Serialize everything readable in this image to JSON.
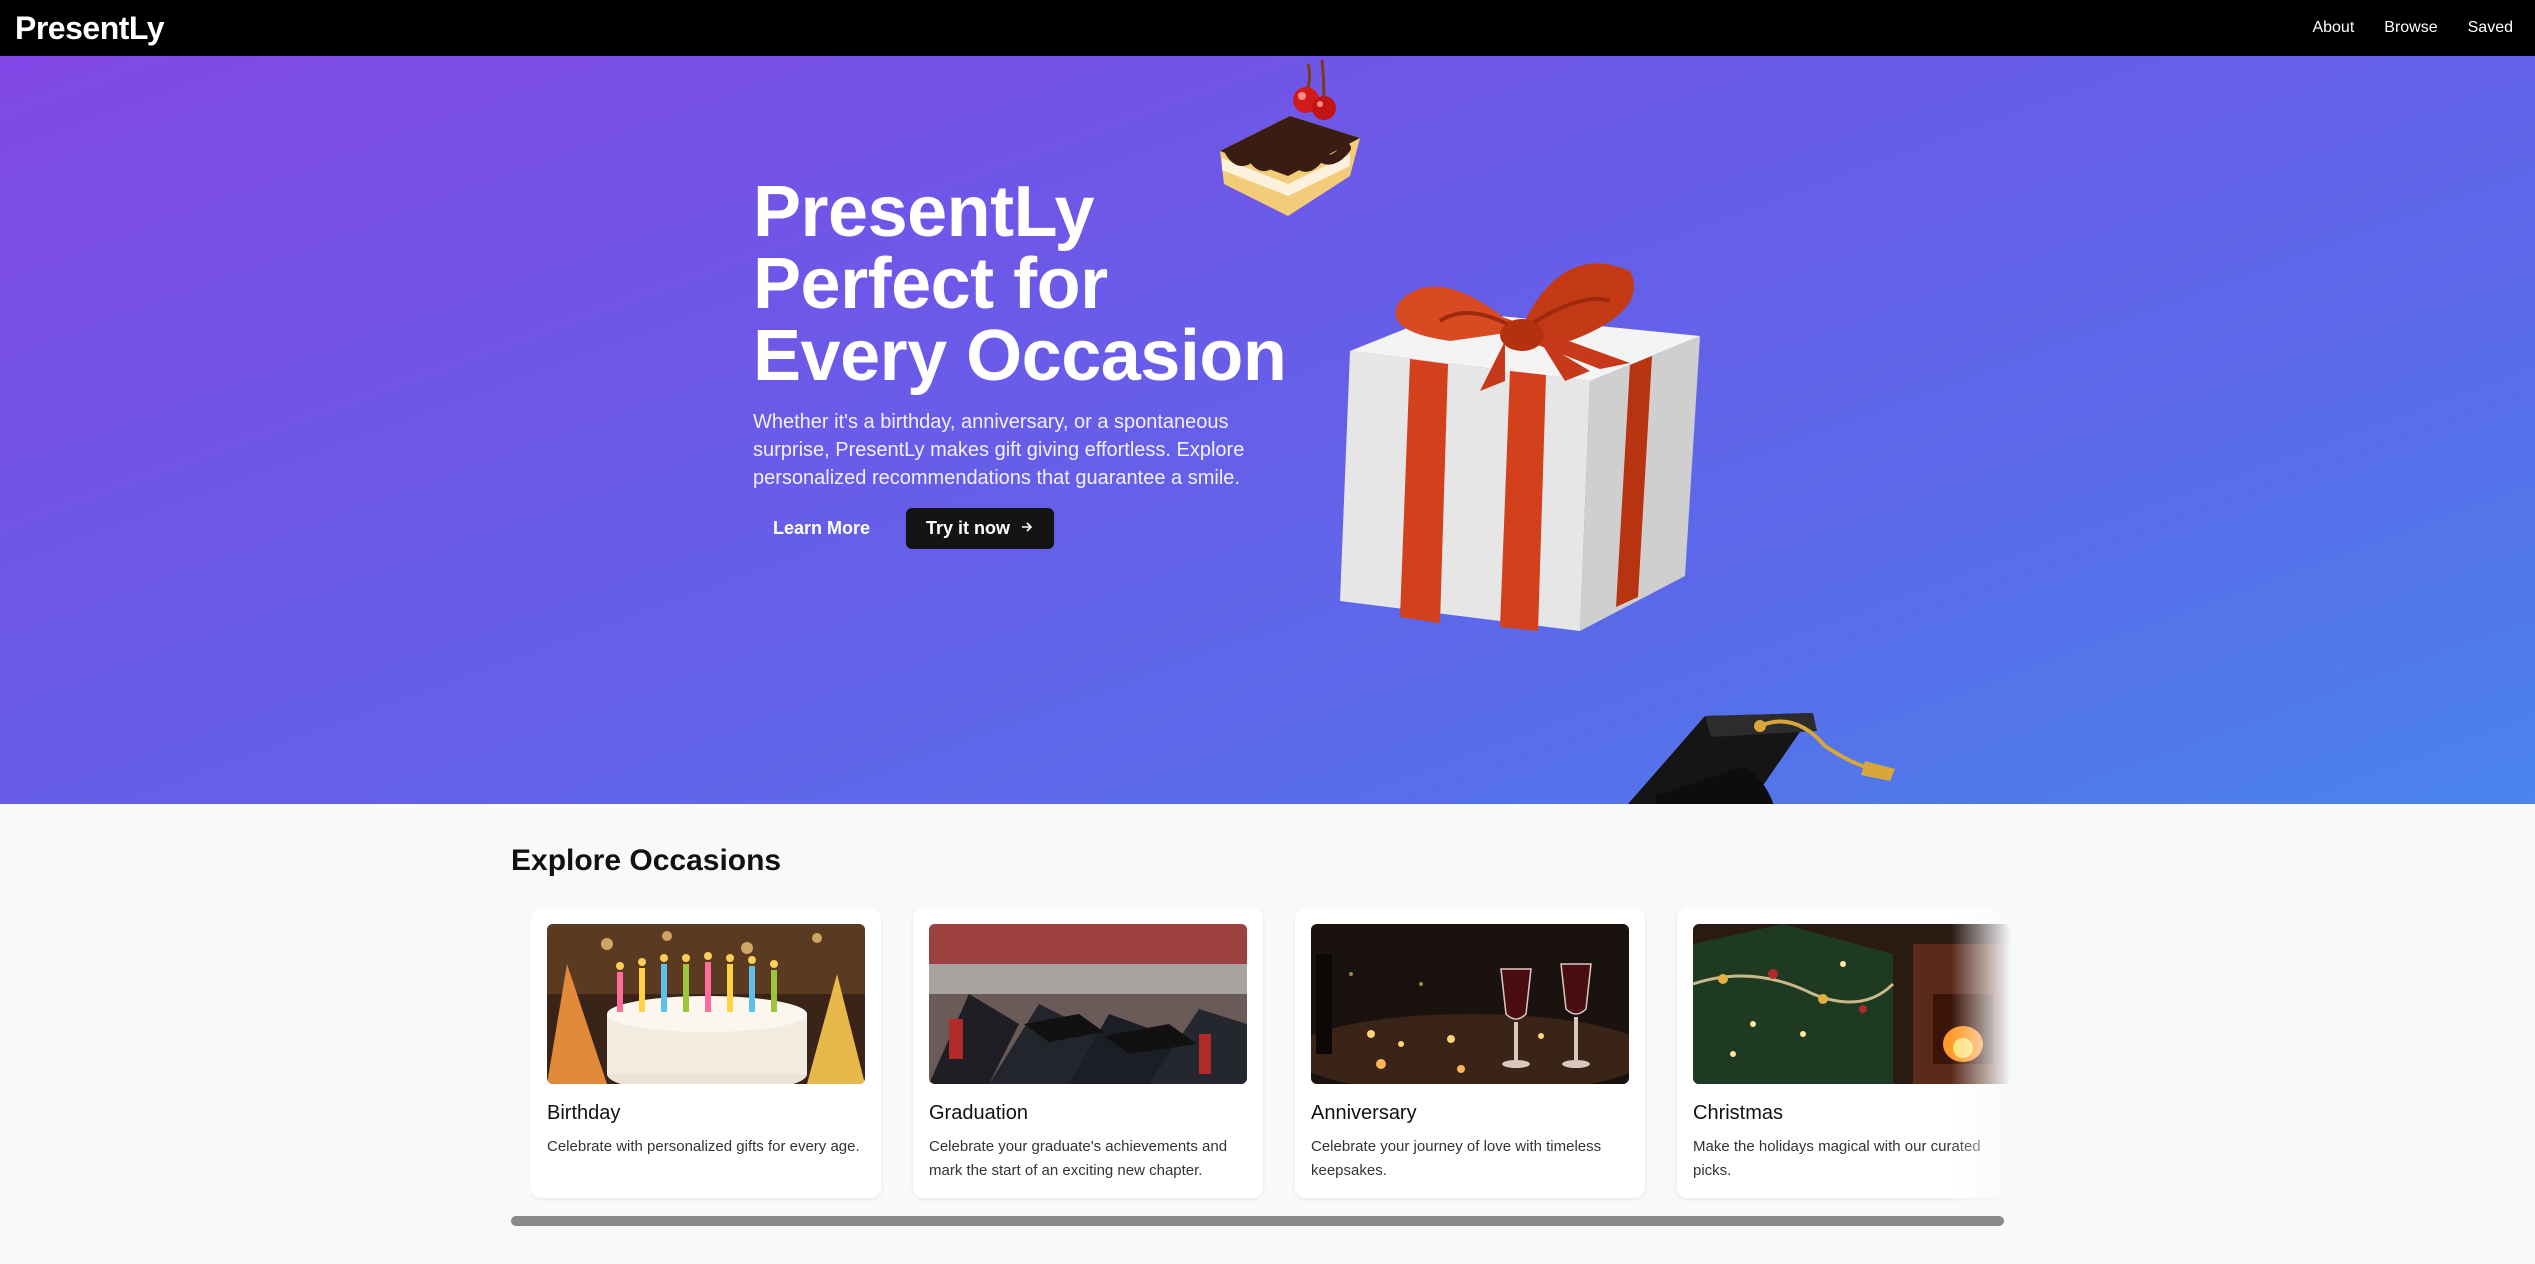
{
  "nav": {
    "brand": "PresentLy",
    "links": [
      "About",
      "Browse",
      "Saved"
    ]
  },
  "hero": {
    "title": "PresentLy Perfect for Every Occasion",
    "description": "Whether it's a birthday, anniversary, or a spontaneous surprise, PresentLy makes gift giving effortless. Explore personalized recommendations that guarantee a smile.",
    "learn_more": "Learn More",
    "try_now": "Try it now",
    "try_now_icon": "arrow-right-icon"
  },
  "explore": {
    "title": "Explore Occasions",
    "cards": [
      {
        "title": "Birthday",
        "description": "Celebrate with personalized gifts for every age."
      },
      {
        "title": "Graduation",
        "description": "Celebrate your graduate's achievements and mark the start of an exciting new chapter."
      },
      {
        "title": "Anniversary",
        "description": "Celebrate your journey of love with timeless keepsakes."
      },
      {
        "title": "Christmas",
        "description": "Make the holidays magical with our curated picks."
      }
    ]
  },
  "colors": {
    "nav_bg": "#000000",
    "hero_gradient_start": "#8148e6",
    "hero_gradient_end": "#4a84ec",
    "primary_button": "#141414",
    "gift_ribbon": "#d2401c"
  }
}
